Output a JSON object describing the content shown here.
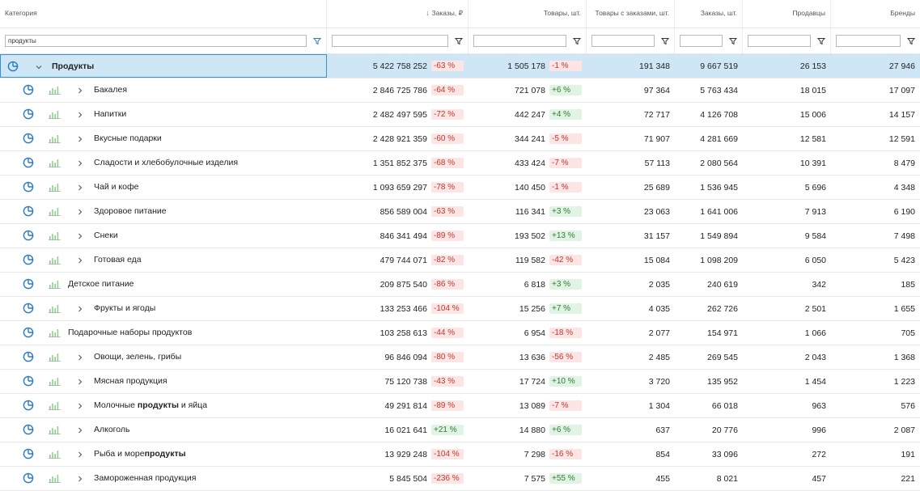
{
  "header": {
    "category": "Категория",
    "orders_rub": "Заказы, ₽",
    "sort_arrow": "↓",
    "goods": "Товары, шт.",
    "goods_with_orders": "Товары с заказами, шт.",
    "orders_qty": "Заказы, шт.",
    "sellers": "Продавцы",
    "brands": "Бренды"
  },
  "filters": {
    "category_value": "продукты",
    "orders_rub_value": "",
    "goods_value": "",
    "goods_with_orders_value": "",
    "orders_qty_value": "",
    "sellers_value": "",
    "brands_value": ""
  },
  "colors": {
    "selected_row": "#cfe6f7",
    "negative": "#c0392b",
    "positive": "#2e7d32",
    "icon": "#2b7bbf"
  },
  "rows": [
    {
      "level": 0,
      "expanded": true,
      "name": [
        {
          "t": "Продукты",
          "b": true
        }
      ],
      "orders": "5 422 758 252",
      "orders_pct": "-63 %",
      "goods": "1 505 178",
      "goods_pct": "-1 %",
      "gwo": "191 348",
      "oq": "9 667 519",
      "sellers": "26 153",
      "brands": "27 946"
    },
    {
      "level": 1,
      "chevron": true,
      "name": [
        {
          "t": "Бакалея"
        }
      ],
      "orders": "2 846 725 786",
      "orders_pct": "-64 %",
      "goods": "721 078",
      "goods_pct": "+6 %",
      "gwo": "97 364",
      "oq": "5 763 434",
      "sellers": "18 015",
      "brands": "17 097"
    },
    {
      "level": 1,
      "chevron": true,
      "name": [
        {
          "t": "Напитки"
        }
      ],
      "orders": "2 482 497 595",
      "orders_pct": "-72 %",
      "goods": "442 247",
      "goods_pct": "+4 %",
      "gwo": "72 717",
      "oq": "4 126 708",
      "sellers": "15 006",
      "brands": "14 157"
    },
    {
      "level": 1,
      "chevron": true,
      "name": [
        {
          "t": "Вкусные подарки"
        }
      ],
      "orders": "2 428 921 359",
      "orders_pct": "-60 %",
      "goods": "344 241",
      "goods_pct": "-5 %",
      "gwo": "71 907",
      "oq": "4 281 669",
      "sellers": "12 581",
      "brands": "12 591"
    },
    {
      "level": 1,
      "chevron": true,
      "name": [
        {
          "t": "Сладости и хлебобулочные изделия"
        }
      ],
      "orders": "1 351 852 375",
      "orders_pct": "-68 %",
      "goods": "433 424",
      "goods_pct": "-7 %",
      "gwo": "57 113",
      "oq": "2 080 564",
      "sellers": "10 391",
      "brands": "8 479"
    },
    {
      "level": 1,
      "chevron": true,
      "name": [
        {
          "t": "Чай и кофе"
        }
      ],
      "orders": "1 093 659 297",
      "orders_pct": "-78 %",
      "goods": "140 450",
      "goods_pct": "-1 %",
      "gwo": "25 689",
      "oq": "1 536 945",
      "sellers": "5 696",
      "brands": "4 348"
    },
    {
      "level": 1,
      "chevron": true,
      "name": [
        {
          "t": "Здоровое питание"
        }
      ],
      "orders": "856 589 004",
      "orders_pct": "-63 %",
      "goods": "116 341",
      "goods_pct": "+3 %",
      "gwo": "23 063",
      "oq": "1 641 006",
      "sellers": "7 913",
      "brands": "6 190"
    },
    {
      "level": 1,
      "chevron": true,
      "name": [
        {
          "t": "Снеки"
        }
      ],
      "orders": "846 341 494",
      "orders_pct": "-89 %",
      "goods": "193 502",
      "goods_pct": "+13 %",
      "gwo": "31 157",
      "oq": "1 549 894",
      "sellers": "9 584",
      "brands": "7 498"
    },
    {
      "level": 1,
      "chevron": true,
      "name": [
        {
          "t": "Готовая еда"
        }
      ],
      "orders": "479 744 071",
      "orders_pct": "-82 %",
      "goods": "119 582",
      "goods_pct": "-42 %",
      "gwo": "15 084",
      "oq": "1 098 209",
      "sellers": "6 050",
      "brands": "5 423"
    },
    {
      "level": 1,
      "chevron": false,
      "name": [
        {
          "t": "Детское питание"
        }
      ],
      "orders": "209 875 540",
      "orders_pct": "-86 %",
      "goods": "6 818",
      "goods_pct": "+3 %",
      "gwo": "2 035",
      "oq": "240 619",
      "sellers": "342",
      "brands": "185"
    },
    {
      "level": 1,
      "chevron": true,
      "name": [
        {
          "t": "Фрукты и ягоды"
        }
      ],
      "orders": "133 253 466",
      "orders_pct": "-104 %",
      "goods": "15 256",
      "goods_pct": "+7 %",
      "gwo": "4 035",
      "oq": "262 726",
      "sellers": "2 501",
      "brands": "1 655"
    },
    {
      "level": 1,
      "chevron": false,
      "name": [
        {
          "t": "Подарочные наборы продуктов"
        }
      ],
      "orders": "103 258 613",
      "orders_pct": "-44 %",
      "goods": "6 954",
      "goods_pct": "-18 %",
      "gwo": "2 077",
      "oq": "154 971",
      "sellers": "1 066",
      "brands": "705"
    },
    {
      "level": 1,
      "chevron": true,
      "name": [
        {
          "t": "Овощи, зелень, грибы"
        }
      ],
      "orders": "96 846 094",
      "orders_pct": "-80 %",
      "goods": "13 636",
      "goods_pct": "-56 %",
      "gwo": "2 485",
      "oq": "269 545",
      "sellers": "2 043",
      "brands": "1 368"
    },
    {
      "level": 1,
      "chevron": true,
      "name": [
        {
          "t": "Мясная продукция"
        }
      ],
      "orders": "75 120 738",
      "orders_pct": "-43 %",
      "goods": "17 724",
      "goods_pct": "+10 %",
      "gwo": "3 720",
      "oq": "135 952",
      "sellers": "1 454",
      "brands": "1 223"
    },
    {
      "level": 1,
      "chevron": true,
      "name": [
        {
          "t": "Молочные "
        },
        {
          "t": "продукты",
          "b": true
        },
        {
          "t": " и яйца"
        }
      ],
      "orders": "49 291 814",
      "orders_pct": "-89 %",
      "goods": "13 089",
      "goods_pct": "-7 %",
      "gwo": "1 304",
      "oq": "66 018",
      "sellers": "963",
      "brands": "576"
    },
    {
      "level": 1,
      "chevron": true,
      "name": [
        {
          "t": "Алкоголь"
        }
      ],
      "orders": "16 021 641",
      "orders_pct": "+21 %",
      "goods": "14 880",
      "goods_pct": "+6 %",
      "gwo": "637",
      "oq": "20 776",
      "sellers": "996",
      "brands": "2 087"
    },
    {
      "level": 1,
      "chevron": true,
      "name": [
        {
          "t": "Рыба и море"
        },
        {
          "t": "продукты",
          "b": true
        }
      ],
      "orders": "13 929 248",
      "orders_pct": "-104 %",
      "goods": "7 298",
      "goods_pct": "-16 %",
      "gwo": "854",
      "oq": "33 096",
      "sellers": "272",
      "brands": "191"
    },
    {
      "level": 1,
      "chevron": true,
      "name": [
        {
          "t": "Замороженная продукция"
        }
      ],
      "orders": "5 845 504",
      "orders_pct": "-236 %",
      "goods": "7 575",
      "goods_pct": "+55 %",
      "gwo": "455",
      "oq": "8 021",
      "sellers": "457",
      "brands": "221"
    }
  ]
}
